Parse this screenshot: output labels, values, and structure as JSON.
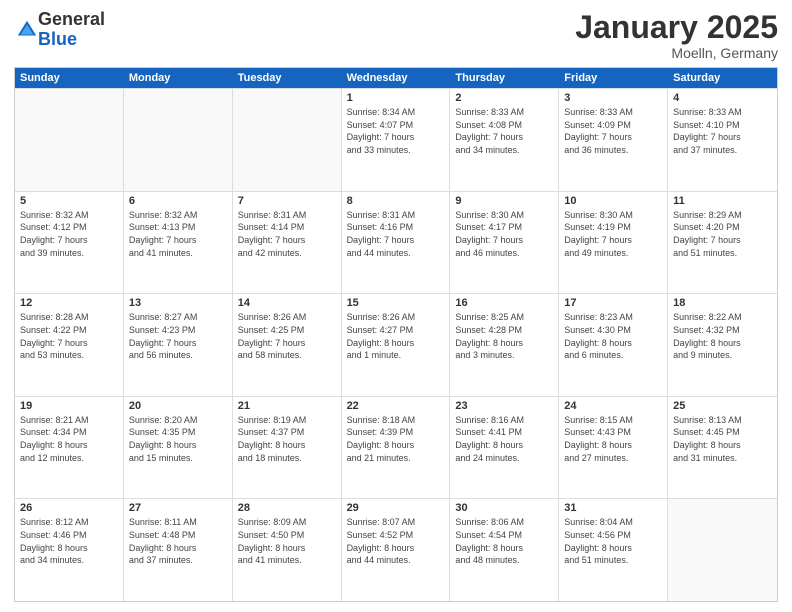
{
  "logo": {
    "line1": "General",
    "line2": "Blue"
  },
  "title": "January 2025",
  "subtitle": "Moelln, Germany",
  "days": [
    "Sunday",
    "Monday",
    "Tuesday",
    "Wednesday",
    "Thursday",
    "Friday",
    "Saturday"
  ],
  "weeks": [
    [
      {
        "day": "",
        "info": ""
      },
      {
        "day": "",
        "info": ""
      },
      {
        "day": "",
        "info": ""
      },
      {
        "day": "1",
        "info": "Sunrise: 8:34 AM\nSunset: 4:07 PM\nDaylight: 7 hours\nand 33 minutes."
      },
      {
        "day": "2",
        "info": "Sunrise: 8:33 AM\nSunset: 4:08 PM\nDaylight: 7 hours\nand 34 minutes."
      },
      {
        "day": "3",
        "info": "Sunrise: 8:33 AM\nSunset: 4:09 PM\nDaylight: 7 hours\nand 36 minutes."
      },
      {
        "day": "4",
        "info": "Sunrise: 8:33 AM\nSunset: 4:10 PM\nDaylight: 7 hours\nand 37 minutes."
      }
    ],
    [
      {
        "day": "5",
        "info": "Sunrise: 8:32 AM\nSunset: 4:12 PM\nDaylight: 7 hours\nand 39 minutes."
      },
      {
        "day": "6",
        "info": "Sunrise: 8:32 AM\nSunset: 4:13 PM\nDaylight: 7 hours\nand 41 minutes."
      },
      {
        "day": "7",
        "info": "Sunrise: 8:31 AM\nSunset: 4:14 PM\nDaylight: 7 hours\nand 42 minutes."
      },
      {
        "day": "8",
        "info": "Sunrise: 8:31 AM\nSunset: 4:16 PM\nDaylight: 7 hours\nand 44 minutes."
      },
      {
        "day": "9",
        "info": "Sunrise: 8:30 AM\nSunset: 4:17 PM\nDaylight: 7 hours\nand 46 minutes."
      },
      {
        "day": "10",
        "info": "Sunrise: 8:30 AM\nSunset: 4:19 PM\nDaylight: 7 hours\nand 49 minutes."
      },
      {
        "day": "11",
        "info": "Sunrise: 8:29 AM\nSunset: 4:20 PM\nDaylight: 7 hours\nand 51 minutes."
      }
    ],
    [
      {
        "day": "12",
        "info": "Sunrise: 8:28 AM\nSunset: 4:22 PM\nDaylight: 7 hours\nand 53 minutes."
      },
      {
        "day": "13",
        "info": "Sunrise: 8:27 AM\nSunset: 4:23 PM\nDaylight: 7 hours\nand 56 minutes."
      },
      {
        "day": "14",
        "info": "Sunrise: 8:26 AM\nSunset: 4:25 PM\nDaylight: 7 hours\nand 58 minutes."
      },
      {
        "day": "15",
        "info": "Sunrise: 8:26 AM\nSunset: 4:27 PM\nDaylight: 8 hours\nand 1 minute."
      },
      {
        "day": "16",
        "info": "Sunrise: 8:25 AM\nSunset: 4:28 PM\nDaylight: 8 hours\nand 3 minutes."
      },
      {
        "day": "17",
        "info": "Sunrise: 8:23 AM\nSunset: 4:30 PM\nDaylight: 8 hours\nand 6 minutes."
      },
      {
        "day": "18",
        "info": "Sunrise: 8:22 AM\nSunset: 4:32 PM\nDaylight: 8 hours\nand 9 minutes."
      }
    ],
    [
      {
        "day": "19",
        "info": "Sunrise: 8:21 AM\nSunset: 4:34 PM\nDaylight: 8 hours\nand 12 minutes."
      },
      {
        "day": "20",
        "info": "Sunrise: 8:20 AM\nSunset: 4:35 PM\nDaylight: 8 hours\nand 15 minutes."
      },
      {
        "day": "21",
        "info": "Sunrise: 8:19 AM\nSunset: 4:37 PM\nDaylight: 8 hours\nand 18 minutes."
      },
      {
        "day": "22",
        "info": "Sunrise: 8:18 AM\nSunset: 4:39 PM\nDaylight: 8 hours\nand 21 minutes."
      },
      {
        "day": "23",
        "info": "Sunrise: 8:16 AM\nSunset: 4:41 PM\nDaylight: 8 hours\nand 24 minutes."
      },
      {
        "day": "24",
        "info": "Sunrise: 8:15 AM\nSunset: 4:43 PM\nDaylight: 8 hours\nand 27 minutes."
      },
      {
        "day": "25",
        "info": "Sunrise: 8:13 AM\nSunset: 4:45 PM\nDaylight: 8 hours\nand 31 minutes."
      }
    ],
    [
      {
        "day": "26",
        "info": "Sunrise: 8:12 AM\nSunset: 4:46 PM\nDaylight: 8 hours\nand 34 minutes."
      },
      {
        "day": "27",
        "info": "Sunrise: 8:11 AM\nSunset: 4:48 PM\nDaylight: 8 hours\nand 37 minutes."
      },
      {
        "day": "28",
        "info": "Sunrise: 8:09 AM\nSunset: 4:50 PM\nDaylight: 8 hours\nand 41 minutes."
      },
      {
        "day": "29",
        "info": "Sunrise: 8:07 AM\nSunset: 4:52 PM\nDaylight: 8 hours\nand 44 minutes."
      },
      {
        "day": "30",
        "info": "Sunrise: 8:06 AM\nSunset: 4:54 PM\nDaylight: 8 hours\nand 48 minutes."
      },
      {
        "day": "31",
        "info": "Sunrise: 8:04 AM\nSunset: 4:56 PM\nDaylight: 8 hours\nand 51 minutes."
      },
      {
        "day": "",
        "info": ""
      }
    ]
  ]
}
